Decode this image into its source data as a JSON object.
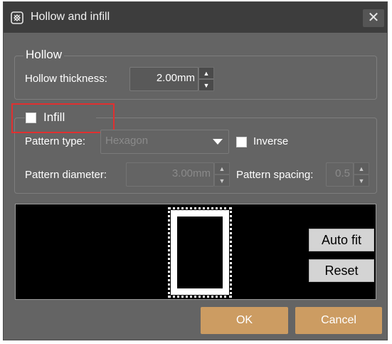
{
  "dialog": {
    "title": "Hollow and infill",
    "close_label": "✕",
    "icon": "hollow-infill-icon"
  },
  "hollow": {
    "legend": "Hollow",
    "thickness_label": "Hollow thickness:",
    "thickness_value": "2.00mm"
  },
  "infill": {
    "legend": "Infill",
    "checked": false,
    "pattern_type_label": "Pattern type:",
    "pattern_type_value": "Hexagon",
    "inverse_label": "Inverse",
    "inverse_checked": false,
    "pattern_diameter_label": "Pattern diameter:",
    "pattern_diameter_value": "3.00mm",
    "pattern_spacing_label": "Pattern spacing:",
    "pattern_spacing_value": "0.5"
  },
  "preview": {
    "auto_fit_label": "Auto fit",
    "reset_label": "Reset"
  },
  "footer": {
    "ok_label": "OK",
    "cancel_label": "Cancel"
  },
  "colors": {
    "highlight": "#e03030",
    "primary_button": "#cc9c62",
    "dialog_bg": "#646464",
    "titlebar_bg": "#3d3d3d"
  }
}
